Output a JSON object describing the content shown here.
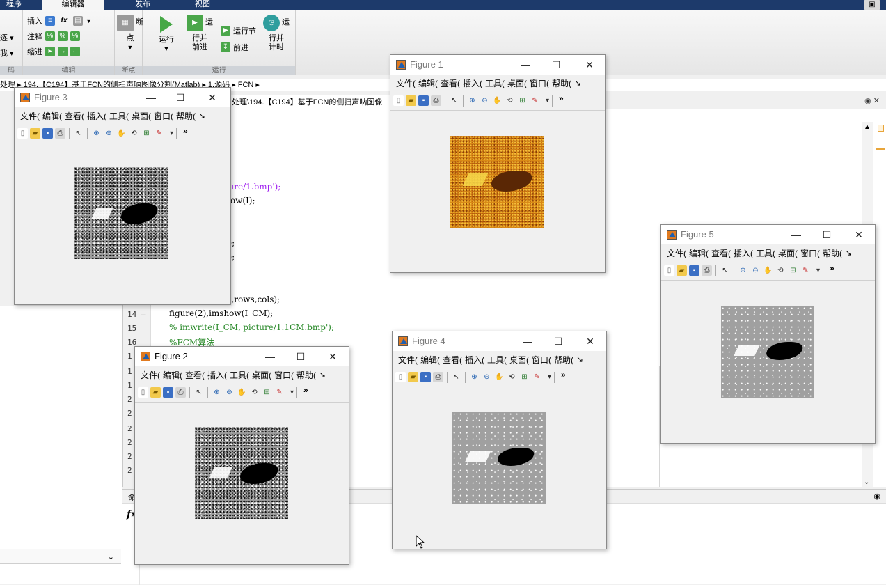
{
  "tabs": [
    "程序",
    "编辑器",
    "发布",
    "视图"
  ],
  "ribbon": {
    "left_partial": [
      "",
      "逐 ▾",
      "我 ▾"
    ],
    "left_partial_label": "码",
    "edit_section": {
      "row1": [
        "插入"
      ],
      "row2": [
        "注释"
      ],
      "row3": [
        "缩进"
      ],
      "label": "编辑"
    },
    "breakpoint": {
      "button": "断点",
      "label": "断点"
    },
    "run_section": {
      "run": "运行",
      "run_advance": [
        "运行并",
        "前进"
      ],
      "run_section": "运行节",
      "advance": "前进",
      "run_time": [
        "运行并",
        "计时"
      ],
      "label": "运行"
    }
  },
  "address": {
    "path": "处理 ▸ 194.【C194】基于FCN的侧扫声呐图像分割(Matlab) ▸ 1.源码 ▸ FCN ▸"
  },
  "editor": {
    "tab_label": "处理\\194.【C194】基于FCN的侧扫声呐图像",
    "code_lines": [
      {
        "ln": "",
        "text": "cture/1.bmp');",
        "cls": "purple"
      },
      {
        "ln": "",
        "text": "show(I);",
        "cls": ""
      },
      {
        "ln": "",
        "text": "I);",
        "cls": ""
      },
      {
        "ln": "",
        "text": ",1);",
        "cls": ""
      },
      {
        "ln": "",
        "text": ",2);",
        "cls": ""
      },
      {
        "ln": "",
        "text": "(I_,rows,cols);",
        "cls": ""
      },
      {
        "ln": "14 —",
        "text": "figure(2),imshow(I_CM);",
        "cls": ""
      },
      {
        "ln": "15",
        "text": "% imwrite(I_CM,'picture/1.1CM.bmp');",
        "cls": "green"
      },
      {
        "ln": "16",
        "text": "%FCM算法",
        "cls": "green"
      },
      {
        "ln": "1",
        "text": "",
        "cls": ""
      },
      {
        "ln": "1",
        "text": "",
        "cls": ""
      },
      {
        "ln": "1",
        "text": ";",
        "cls": ""
      },
      {
        "ln": "2",
        "text": "",
        "cls": ""
      },
      {
        "ln": "2",
        "text": "",
        "cls": ""
      },
      {
        "ln": "2",
        "text": "');",
        "cls": ""
      },
      {
        "ln": "2",
        "text": "",
        "cls": ""
      },
      {
        "ln": "2",
        "text": "",
        "cls": ""
      },
      {
        "ln": "2",
        "text": "",
        "cls": ""
      }
    ]
  },
  "cmdwin": {
    "title": "命",
    "fx": "fx"
  },
  "figure_menu": [
    "文件(",
    "编辑(",
    "查看(",
    "插入(",
    "工具(",
    "桌面(",
    "窗口(",
    "帮助(",
    "↘"
  ],
  "figures": {
    "f1": {
      "title": "Figure 1"
    },
    "f2": {
      "title": "Figure 2"
    },
    "f3": {
      "title": "Figure 3"
    },
    "f4": {
      "title": "Figure 4"
    },
    "f5": {
      "title": "Figure 5"
    }
  },
  "window_buttons": {
    "minimize": "—",
    "maximize": "☐",
    "close": "✕"
  },
  "toolbar_more": "»"
}
